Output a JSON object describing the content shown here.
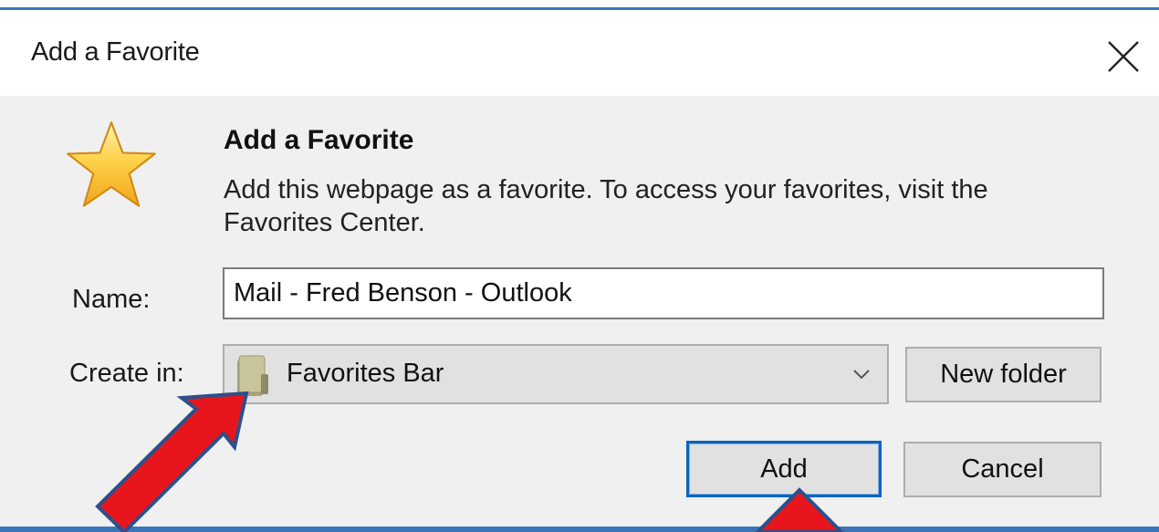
{
  "window": {
    "title": "Add a Favorite",
    "close_icon": "close-icon",
    "accent_color": "#3b77b8"
  },
  "header": {
    "icon": "star-icon",
    "heading": "Add a Favorite",
    "description": "Add this webpage as a favorite. To access your favorites, visit the Favorites Center."
  },
  "form": {
    "name_label": "Name:",
    "name_value": "Mail - Fred Benson - Outlook",
    "create_in_label": "Create in:",
    "create_in_value": "Favorites Bar",
    "create_in_icon": "folder-icon",
    "dropdown_icon": "chevron-down-icon",
    "new_folder_label": "New folder"
  },
  "buttons": {
    "add_label": "Add",
    "cancel_label": "Cancel",
    "default_button_border": "#0a63bd"
  },
  "annotations": {
    "arrow_color": "#e8161c",
    "arrow_outline_color": "#2f4f8a"
  }
}
